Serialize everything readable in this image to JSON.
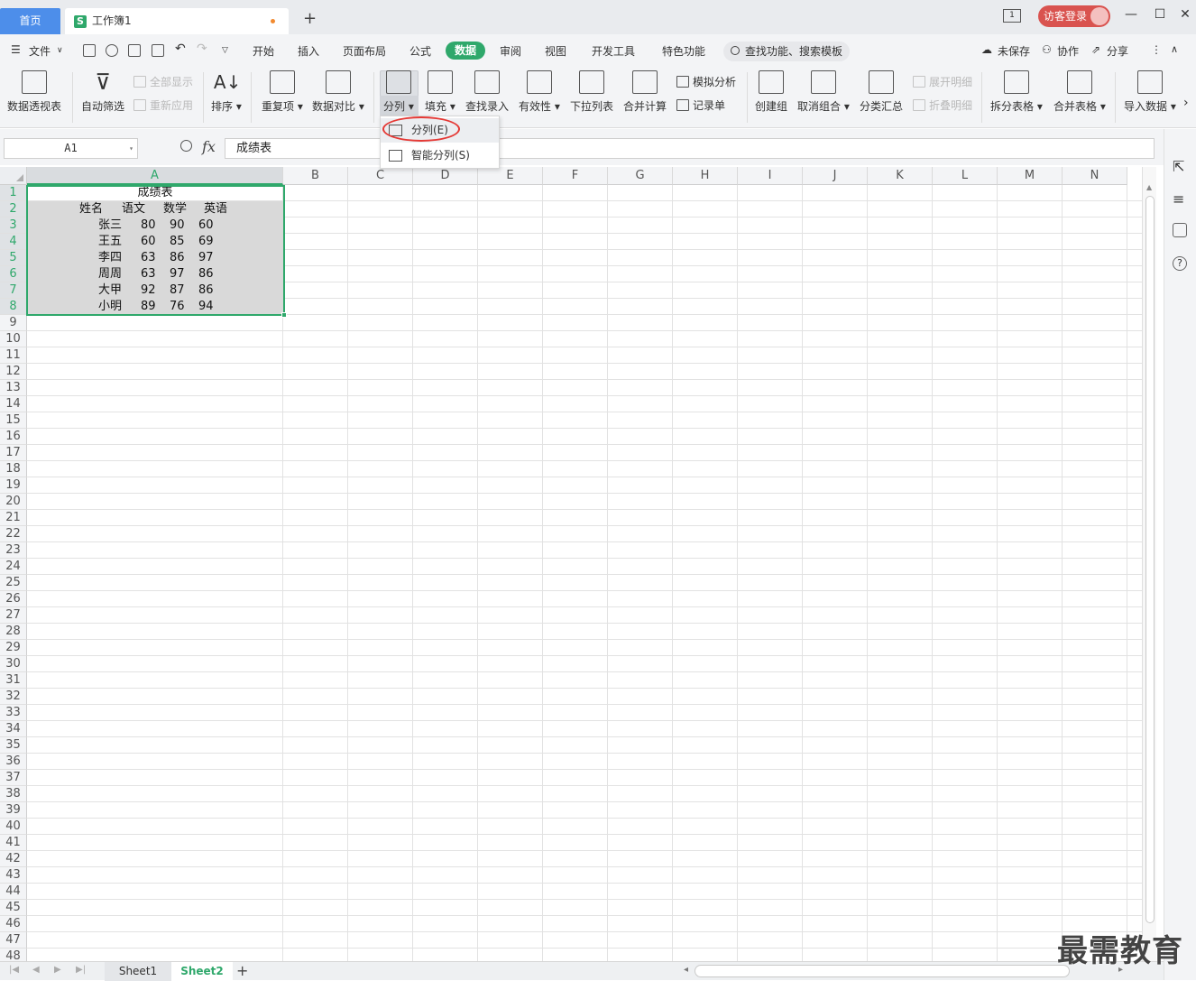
{
  "titlebar": {
    "home_tab": "首页",
    "workbook_tab": "工作簿1",
    "login_label": "访客登录",
    "restore_label": "1"
  },
  "menu": {
    "file": "文件",
    "items": [
      "开始",
      "插入",
      "页面布局",
      "公式",
      "数据",
      "审阅",
      "视图",
      "开发工具",
      "特色功能"
    ],
    "search_placeholder": "查找功能、搜索模板",
    "unsaved": "未保存",
    "collaborate": "协作",
    "share": "分享"
  },
  "ribbon": {
    "pivot": "数据透视表",
    "autofilter": "自动筛选",
    "show_all": "全部显示",
    "reapply": "重新应用",
    "sort": "排序",
    "duplicates": "重复项",
    "compare": "数据对比",
    "split": "分列",
    "fill": "填充",
    "lookup": "查找录入",
    "validity": "有效性",
    "dropdown_list": "下拉列表",
    "consolidate": "合并计算",
    "whatif": "模拟分析",
    "record": "记录单",
    "group": "创建组",
    "ungroup": "取消组合",
    "subtotal": "分类汇总",
    "expand": "展开明细",
    "collapse": "折叠明细",
    "split_table": "拆分表格",
    "merge_table": "合并表格",
    "import": "导入数据"
  },
  "dropdown": {
    "split_item": "分列(E)",
    "smart_split_item": "智能分列(S)"
  },
  "formula_bar": {
    "cell_ref": "A1",
    "fx": "fx",
    "content": "成绩表"
  },
  "grid": {
    "columns": [
      "A",
      "B",
      "C",
      "D",
      "E",
      "F",
      "G",
      "H",
      "I",
      "J",
      "K",
      "L",
      "M",
      "N"
    ],
    "rows_count": 48,
    "title": "成绩表",
    "header": [
      "姓名",
      "语文",
      "数学",
      "英语"
    ],
    "records": [
      [
        "张三",
        "80",
        "90",
        "60"
      ],
      [
        "王五",
        "60",
        "85",
        "69"
      ],
      [
        "李四",
        "63",
        "86",
        "97"
      ],
      [
        "周周",
        "63",
        "97",
        "86"
      ],
      [
        "大甲",
        "92",
        "87",
        "86"
      ],
      [
        "小明",
        "89",
        "76",
        "94"
      ]
    ]
  },
  "sheets": {
    "sheet1": "Sheet1",
    "sheet2": "Sheet2"
  },
  "watermark": "最需教育",
  "colors": {
    "accent_green": "#2fa86b",
    "home_tab_blue": "#4d8eea",
    "login_red": "#d9534f",
    "circle_red": "#e53935"
  }
}
